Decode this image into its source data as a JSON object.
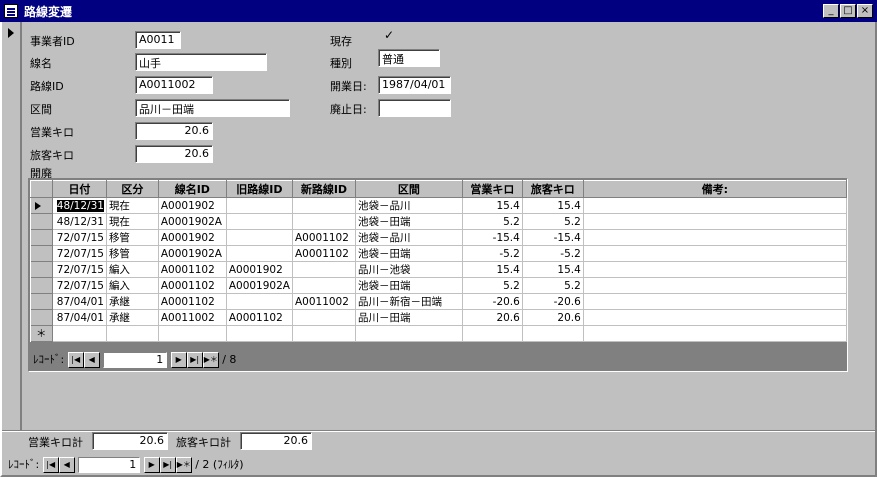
{
  "window": {
    "title": "路線変遷"
  },
  "titlebar_buttons": {
    "minimize": "_",
    "maximize": "□",
    "close": "×"
  },
  "form": {
    "operator_id_label": "事業者ID",
    "operator_id": "A0011",
    "line_name_label": "線名",
    "line_name": "山手",
    "route_id_label": "路線ID",
    "route_id": "A0011002",
    "section_label": "区間",
    "section": "品川－田端",
    "op_km_label": "営業キロ",
    "op_km": "20.6",
    "pass_km_label": "旅客キロ",
    "pass_km": "20.6",
    "current_label": "現存",
    "current_checked": "✓",
    "type_label": "種別",
    "type": "普通",
    "open_date_label": "開業日:",
    "open_date": "1987/04/01",
    "close_date_label": "廃止日:",
    "close_date": "",
    "history_label": "開廃"
  },
  "table": {
    "headers": [
      "日付",
      "区分",
      "線名ID",
      "旧路線ID",
      "新路線ID",
      "区間",
      "営業キロ",
      "旅客キロ",
      "備考:"
    ],
    "rows": [
      [
        "48/12/31",
        "現在",
        "A0001902",
        "",
        "",
        "池袋－品川",
        "15.4",
        "15.4",
        ""
      ],
      [
        "48/12/31",
        "現在",
        "A0001902A",
        "",
        "",
        "池袋－田端",
        "5.2",
        "5.2",
        ""
      ],
      [
        "72/07/15",
        "移管",
        "A0001902",
        "",
        "A0001102",
        "池袋－品川",
        "-15.4",
        "-15.4",
        ""
      ],
      [
        "72/07/15",
        "移管",
        "A0001902A",
        "",
        "A0001102",
        "池袋－田端",
        "-5.2",
        "-5.2",
        ""
      ],
      [
        "72/07/15",
        "編入",
        "A0001102",
        "A0001902",
        "",
        "品川－池袋",
        "15.4",
        "15.4",
        ""
      ],
      [
        "72/07/15",
        "編入",
        "A0001102",
        "A0001902A",
        "",
        "池袋－田端",
        "5.2",
        "5.2",
        ""
      ],
      [
        "87/04/01",
        "承継",
        "A0001102",
        "",
        "A0011002",
        "品川－新宿－田端",
        "-20.6",
        "-20.6",
        ""
      ],
      [
        "87/04/01",
        "承継",
        "A0011002",
        "A0001102",
        "",
        "品川－田端",
        "20.6",
        "20.6",
        ""
      ]
    ],
    "new_row_marker": "＊"
  },
  "subform_nav": {
    "label": "ﾚｺｰﾄﾞ:",
    "current": "1",
    "total": "/ 8",
    "first": "|◀",
    "prev": "◀",
    "next": "▶",
    "last": "▶|",
    "new": "▶＊"
  },
  "totals": {
    "op_km_total_label": "営業キロ計",
    "op_km_total": "20.6",
    "pass_km_total_label": "旅客キロ計",
    "pass_km_total": "20.6"
  },
  "main_nav": {
    "label": "ﾚｺｰﾄﾞ:",
    "current": "1",
    "total": "/ 2 (ﾌｨﾙﾀ)",
    "first": "|◀",
    "prev": "◀",
    "next": "▶",
    "last": "▶|",
    "new": "▶＊"
  }
}
